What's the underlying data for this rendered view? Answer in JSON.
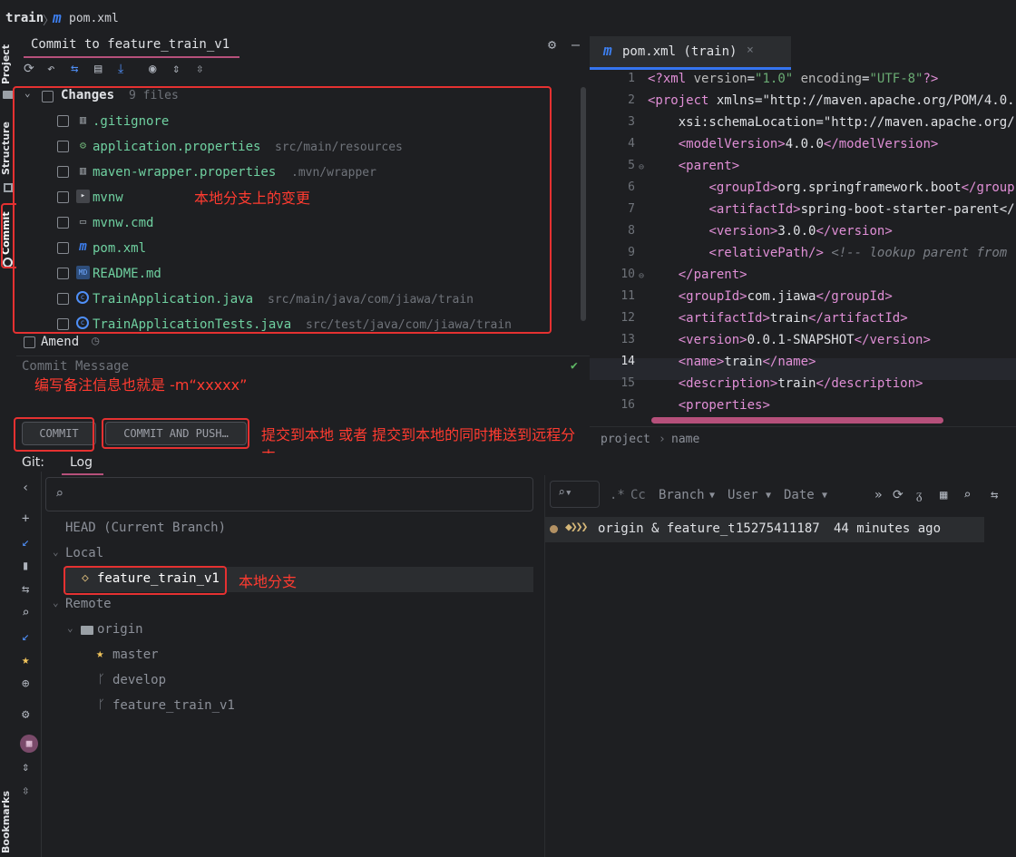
{
  "breadcrumb": {
    "project": "train",
    "separator": "〉",
    "file": "pom.xml"
  },
  "left_strip": {
    "project": "Project",
    "structure": "Structure",
    "commit": "Commit",
    "bookmarks": "Bookmarks"
  },
  "commit_panel": {
    "title": "Commit to feature_train_v1",
    "changes_label": "Changes",
    "changes_count": "9 files",
    "files": [
      {
        "name": ".gitignore",
        "path": "",
        "icon": "gitignore-icon"
      },
      {
        "name": "application.properties",
        "path": "src/main/resources",
        "icon": "properties-icon"
      },
      {
        "name": "maven-wrapper.properties",
        "path": ".mvn/wrapper",
        "icon": "properties-icon"
      },
      {
        "name": "mvnw",
        "path": "",
        "icon": "shell-icon"
      },
      {
        "name": "mvnw.cmd",
        "path": "",
        "icon": "file-icon"
      },
      {
        "name": "pom.xml",
        "path": "",
        "icon": "maven-icon"
      },
      {
        "name": "README.md",
        "path": "",
        "icon": "markdown-icon"
      },
      {
        "name": "TrainApplication.java",
        "path": "src/main/java/com/jiawa/train",
        "icon": "java-class-icon"
      },
      {
        "name": "TrainApplicationTests.java",
        "path": "src/test/java/com/jiawa/train",
        "icon": "java-class-icon"
      }
    ],
    "amend_label": "Amend",
    "message_placeholder": "Commit Message",
    "commit_button": "COMMIT",
    "commit_push_button": "COMMIT AND PUSH…"
  },
  "annotations": {
    "local_changes": "本地分支上的变更",
    "commit_message": "编写备注信息也就是 -m“xxxxx”",
    "commit_actions": "提交到本地 或者 提交到本地的同时推送到远程分支",
    "local_branch": "本地分支"
  },
  "editor": {
    "tab_label": "pom.xml (train)",
    "current_line": 14,
    "lines": [
      {
        "n": "1",
        "text": "<?xml version=\"1.0\" encoding=\"UTF-8\"?>"
      },
      {
        "n": "2",
        "text": "<project xmlns=\"http://maven.apache.org/POM/4.0."
      },
      {
        "n": "3",
        "text": "    xsi:schemaLocation=\"http://maven.apache.org/"
      },
      {
        "n": "4",
        "text": "    <modelVersion>4.0.0</modelVersion>"
      },
      {
        "n": "5",
        "text": "    <parent>"
      },
      {
        "n": "6",
        "text": "        <groupId>org.springframework.boot</group"
      },
      {
        "n": "7",
        "text": "        <artifactId>spring-boot-starter-parent</"
      },
      {
        "n": "8",
        "text": "        <version>3.0.0</version>"
      },
      {
        "n": "9",
        "text": "        <relativePath/> <!-- lookup parent from"
      },
      {
        "n": "10",
        "text": "    </parent>"
      },
      {
        "n": "11",
        "text": "    <groupId>com.jiawa</groupId>"
      },
      {
        "n": "12",
        "text": "    <artifactId>train</artifactId>"
      },
      {
        "n": "13",
        "text": "    <version>0.0.1-SNAPSHOT</version>"
      },
      {
        "n": "14",
        "text": "    <name>train</name>"
      },
      {
        "n": "15",
        "text": "    <description>train</description>"
      },
      {
        "n": "16",
        "text": "    <properties>"
      }
    ],
    "breadcrumb": [
      "project",
      "name"
    ]
  },
  "git": {
    "tab_prefix": "Git:",
    "tab_log": "Log",
    "branches": {
      "head": "HEAD (Current Branch)",
      "local_label": "Local",
      "local": [
        "feature_train_v1"
      ],
      "remote_label": "Remote",
      "remote_root": "origin",
      "remote": [
        "master",
        "develop",
        "feature_train_v1"
      ]
    },
    "log_toolbar": {
      "cc": "Cc",
      "branch": "Branch",
      "user": "User",
      "date": "Date"
    },
    "commits": [
      {
        "refs": "origin & feature_tr",
        "author": "15275411187",
        "time": "44 minutes ago"
      }
    ]
  }
}
